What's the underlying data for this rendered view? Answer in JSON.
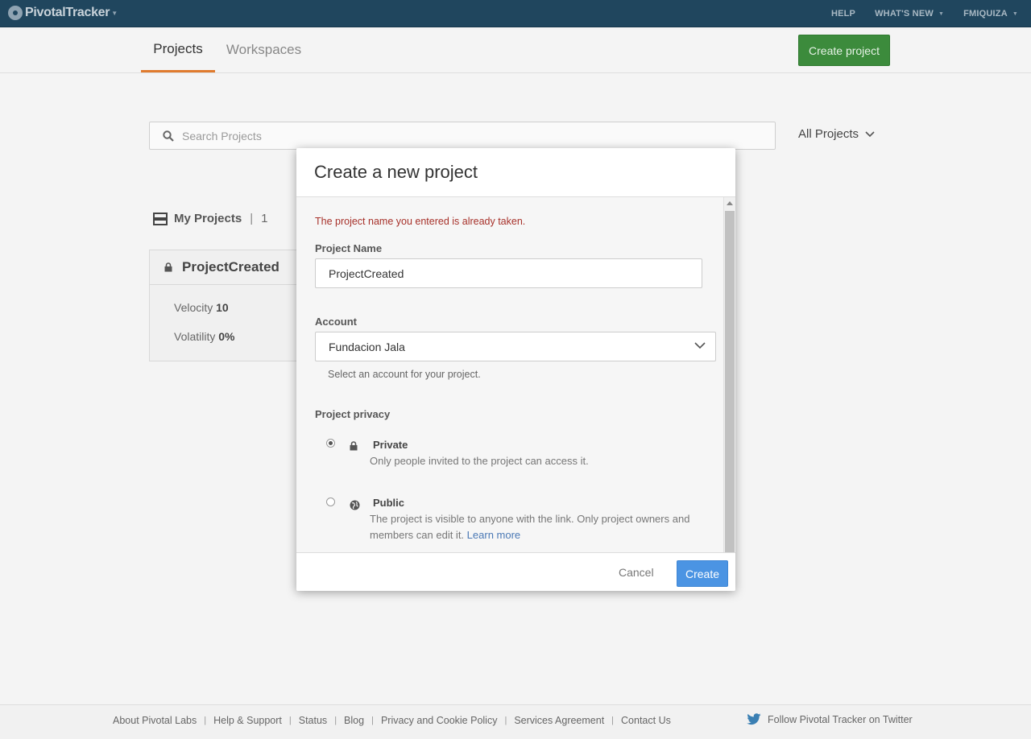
{
  "topbar": {
    "logo": "PivotalTracker",
    "links": {
      "help": "HELP",
      "whats_new": "WHAT'S NEW",
      "user": "FMIQUIZA"
    }
  },
  "tabs": {
    "projects": "Projects",
    "workspaces": "Workspaces"
  },
  "create_project_label": "Create project",
  "search": {
    "placeholder": "Search Projects"
  },
  "filter": {
    "label": "All Projects"
  },
  "my_projects": {
    "label": "My Projects",
    "separator": "|",
    "count": "1"
  },
  "project_card": {
    "title": "ProjectCreated",
    "velocity_label": "Velocity",
    "velocity_value": "10",
    "volatility_label": "Volatility",
    "volatility_value": "0%"
  },
  "modal": {
    "title": "Create a new project",
    "error": "The project name you entered is already taken.",
    "name_label": "Project Name",
    "name_value": "ProjectCreated",
    "account_label": "Account",
    "account_value": "Fundacion Jala",
    "account_help": "Select an account for your project.",
    "privacy_label": "Project privacy",
    "private_title": "Private",
    "private_desc": "Only people invited to the project can access it.",
    "public_title": "Public",
    "public_desc": "The project is visible to anyone with the link. Only project owners and members can edit it.",
    "learn_more": "Learn more",
    "cancel": "Cancel",
    "create": "Create"
  },
  "footer": {
    "links": [
      "About Pivotal Labs",
      "Help & Support",
      "Status",
      "Blog",
      "Privacy and Cookie Policy",
      "Services Agreement",
      "Contact Us"
    ],
    "twitter": "Follow Pivotal Tracker on Twitter"
  },
  "colors": {
    "topbar": "#20465e",
    "active_tab": "#e07b2e",
    "create_project": "#3c8b3c",
    "create_button": "#4b94e3",
    "error": "#a7312a"
  }
}
